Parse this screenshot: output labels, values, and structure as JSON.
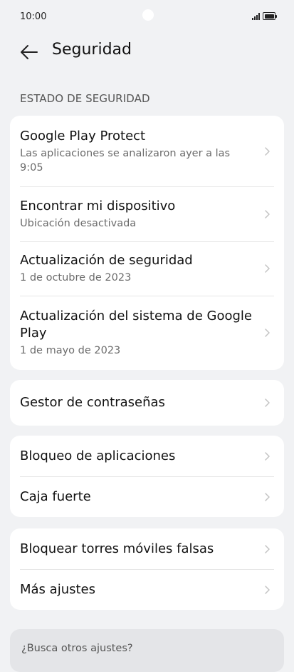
{
  "status": {
    "time": "10:00"
  },
  "header": {
    "title": "Seguridad"
  },
  "section_label": "ESTADO DE SEGURIDAD",
  "status_card": [
    {
      "title": "Google Play Protect",
      "subtitle": "Las aplicaciones se analizaron ayer a las 9:05"
    },
    {
      "title": "Encontrar mi dispositivo",
      "subtitle": "Ubicación desactivada"
    },
    {
      "title": "Actualización de seguridad",
      "subtitle": "1 de octubre de 2023"
    },
    {
      "title": "Actualización del sistema de Google Play",
      "subtitle": "1 de mayo de 2023"
    }
  ],
  "password_card": [
    {
      "title": "Gestor de contraseñas"
    }
  ],
  "apps_card": [
    {
      "title": "Bloqueo de aplicaciones"
    },
    {
      "title": "Caja fuerte"
    }
  ],
  "more_card": [
    {
      "title": "Bloquear torres móviles falsas"
    },
    {
      "title": "Más ajustes"
    }
  ],
  "search_prompt": "¿Busca otros ajustes?",
  "colors": {
    "background": "#f1f2f4",
    "card": "#ffffff",
    "search_card": "#e4e5e8",
    "chevron": "#c4c4c4"
  }
}
